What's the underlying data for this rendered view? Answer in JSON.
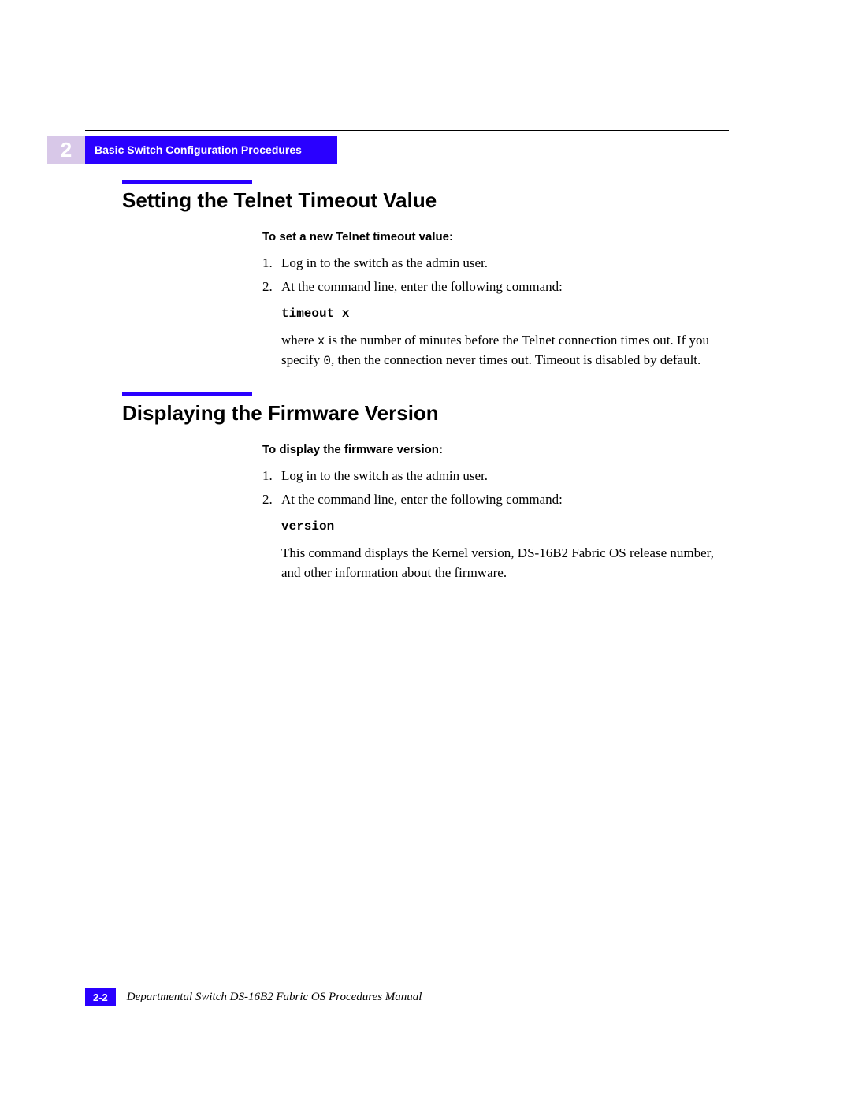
{
  "chapter_number": "2",
  "header_title": "Basic Switch Configuration Procedures",
  "section1": {
    "title": "Setting the Telnet Timeout Value",
    "sub": "To set a new Telnet timeout value:",
    "step1": "Log in to the switch as the admin user.",
    "step2": "At the command line, enter the following command:",
    "cmd": "timeout x",
    "para_a": "where ",
    "para_x": "x",
    "para_b": " is the number of minutes before the Telnet connection times out. If you specify ",
    "para_zero": "0",
    "para_c": ", then the connection never times out. Timeout is disabled by default."
  },
  "section2": {
    "title": "Displaying the Firmware Version",
    "sub": "To display the firmware version:",
    "step1": "Log in to the switch as the admin user.",
    "step2": "At the command line, enter the following command:",
    "cmd": "version",
    "para": "This command displays the Kernel version, DS-16B2 Fabric OS release number, and other information about the firmware."
  },
  "footer": {
    "page": "2-2",
    "text": "Departmental Switch DS-16B2 Fabric OS Procedures Manual"
  },
  "nums": {
    "one": "1.",
    "two": "2."
  }
}
